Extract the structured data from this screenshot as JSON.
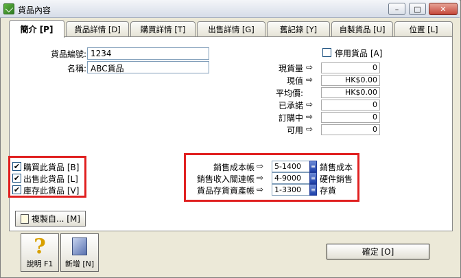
{
  "window": {
    "title": "貨品內容"
  },
  "titlebar_buttons": {
    "minimize": "–",
    "maximize": "□",
    "close": "✕"
  },
  "tabs": [
    {
      "label": "簡介 [P]"
    },
    {
      "label": "貨品詳情 [D]"
    },
    {
      "label": "購買詳情 [T]"
    },
    {
      "label": "出售詳情 [G]"
    },
    {
      "label": "舊記錄 [Y]"
    },
    {
      "label": "自製貨品 [U]"
    },
    {
      "label": "位置 [L]"
    }
  ],
  "item": {
    "number_label": "貨品編號:",
    "number_value": "1234",
    "name_label": "名稱:",
    "name_value": "ABC貨品"
  },
  "inactive": {
    "label": "停用貨品 [A]",
    "checked": false
  },
  "stock": [
    {
      "label": "現貨量",
      "value": "0"
    },
    {
      "label": "現值",
      "value": "HK$0.00"
    },
    {
      "label": "平均價:",
      "value": "HK$0.00"
    },
    {
      "label": "已承諾",
      "value": "0"
    },
    {
      "label": "訂購中",
      "value": "0"
    },
    {
      "label": "可用",
      "value": "0"
    }
  ],
  "flags": [
    {
      "label": "購買此貨品 [B]",
      "checked": true
    },
    {
      "label": "出售此貨品 [L]",
      "checked": true
    },
    {
      "label": "庫存此貨品 [V]",
      "checked": true
    }
  ],
  "accounts": [
    {
      "label": "銷售成本帳",
      "code": "5-1400",
      "name": "銷售成本"
    },
    {
      "label": "銷售收入關連帳",
      "code": "4-9000",
      "name": "硬件銷售"
    },
    {
      "label": "貨品存貨資產帳",
      "code": "1-3300",
      "name": "存貨"
    }
  ],
  "copy_button": {
    "label": "複製自... [M]"
  },
  "toolbar": {
    "help_label": "說明 F1",
    "new_label": "新增 [N]"
  },
  "ok_button": {
    "label": "確定 [O]"
  },
  "glyphs": {
    "arrow": "⇨",
    "check": "✔"
  },
  "colors": {
    "highlight_border": "#e02020",
    "panel_bg": "#ece9d8"
  }
}
